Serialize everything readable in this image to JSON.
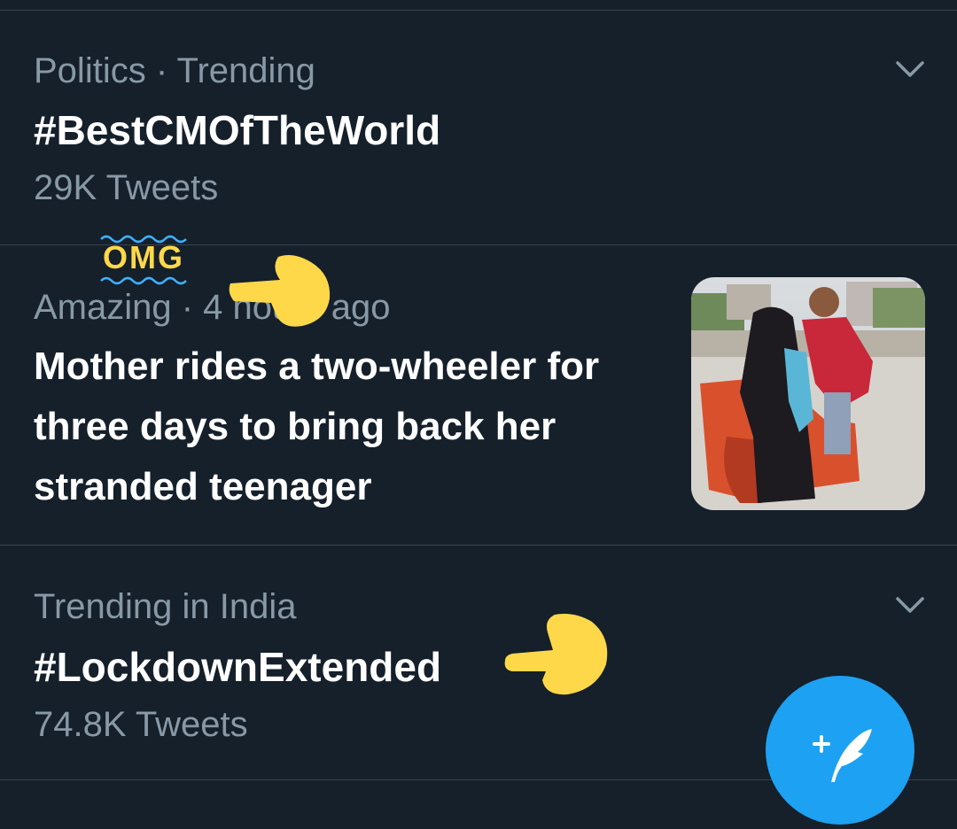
{
  "trends": [
    {
      "meta": "Politics · Trending",
      "title": "#BestCMOfTheWorld",
      "count": "29K Tweets"
    },
    {
      "meta": "Trending in India",
      "title": "#LockdownExtended",
      "count": "74.8K Tweets"
    }
  ],
  "news": {
    "meta": "Amazing · 4 hours ago",
    "headline": "Mother rides a two-wheeler for three days to bring back her stranded teenager"
  },
  "annotation": {
    "label": "OMG"
  },
  "icons": {
    "chevron": "chevron-down-icon",
    "fab": "compose-tweet-icon",
    "pointer": "pointing-hand-icon"
  },
  "colors": {
    "background": "#15202b",
    "accent": "#1da1f2",
    "secondary_text": "#8899a6",
    "annotation": "#ffd84a"
  }
}
